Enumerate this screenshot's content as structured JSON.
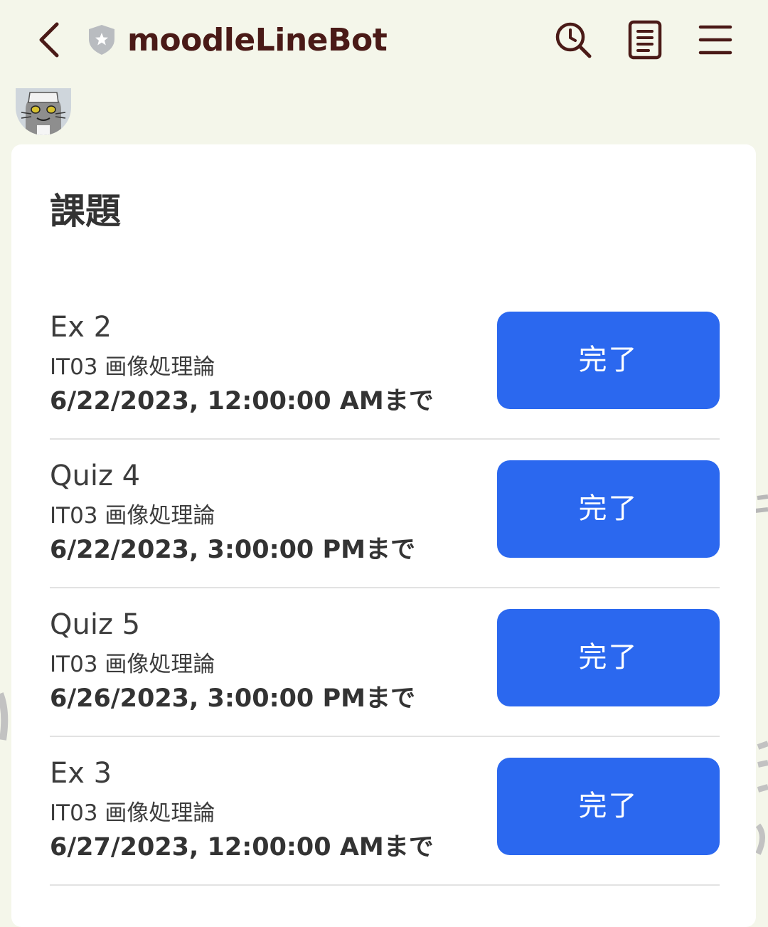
{
  "header": {
    "title": "moodleLineBot"
  },
  "icons": {
    "back": "chevron-left-icon",
    "badge": "shield-star-icon",
    "search": "clock-search-icon",
    "notes": "notes-icon",
    "menu": "hamburger-menu-icon"
  },
  "colors": {
    "background": "#f4f6ea",
    "title": "#4a1a17",
    "button": "#2b68ef",
    "card": "#ffffff"
  },
  "card": {
    "title": "課題",
    "items": [
      {
        "name": "Ex 2",
        "course": "IT03 画像処理論",
        "due": "6/22/2023, 12:00:00 AMまで",
        "button": "完了"
      },
      {
        "name": "Quiz 4",
        "course": "IT03 画像処理論",
        "due": "6/22/2023, 3:00:00 PMまで",
        "button": "完了"
      },
      {
        "name": "Quiz 5",
        "course": "IT03 画像処理論",
        "due": "6/26/2023, 3:00:00 PMまで",
        "button": "完了"
      },
      {
        "name": "Ex 3",
        "course": "IT03 画像処理論",
        "due": "6/27/2023, 12:00:00 AMまで",
        "button": "完了"
      }
    ]
  }
}
